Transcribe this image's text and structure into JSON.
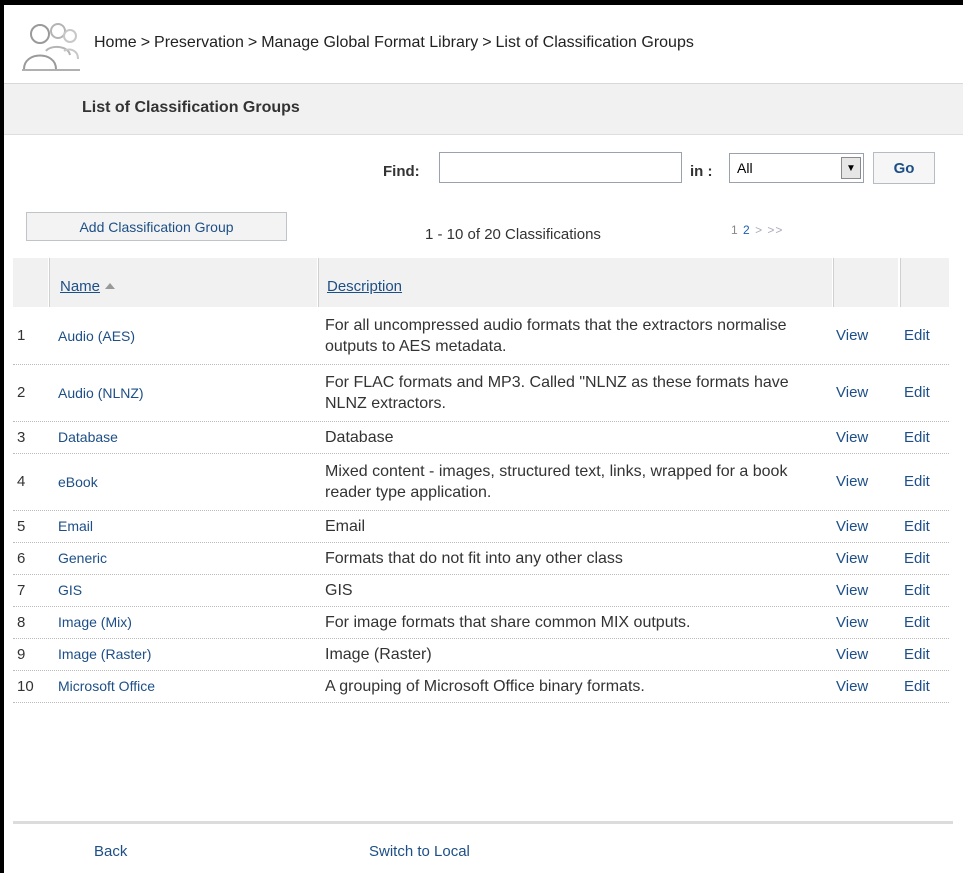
{
  "breadcrumb": [
    "Home",
    "Preservation",
    "Manage Global Format Library",
    "List of Classification Groups"
  ],
  "breadcrumb_separator": ">",
  "page_title": "List of Classification Groups",
  "find": {
    "label": "Find:",
    "value": "",
    "in_label": "in :",
    "in_selected": "All",
    "go_label": "Go"
  },
  "toolbar": {
    "add_label": "Add Classification Group",
    "count_text": "1 - 10 of 20 Classifications",
    "pages": [
      "1",
      "2"
    ],
    "next": ">",
    "last": ">>"
  },
  "table": {
    "columns": {
      "name": "Name",
      "description": "Description"
    },
    "rows": [
      {
        "num": "1",
        "name": "Audio (AES)",
        "desc": "For all uncompressed audio formats that the extractors normalise outputs to AES metadata.",
        "view": "View",
        "edit": "Edit"
      },
      {
        "num": "2",
        "name": "Audio (NLNZ)",
        "desc": "For FLAC formats and MP3. Called \"NLNZ as these formats have NLNZ extractors.",
        "view": "View",
        "edit": "Edit"
      },
      {
        "num": "3",
        "name": "Database",
        "desc": "Database",
        "view": "View",
        "edit": "Edit"
      },
      {
        "num": "4",
        "name": "eBook",
        "desc": "Mixed content - images, structured text, links, wrapped for a book reader type application.",
        "view": "View",
        "edit": "Edit"
      },
      {
        "num": "5",
        "name": "Email",
        "desc": "Email",
        "view": "View",
        "edit": "Edit"
      },
      {
        "num": "6",
        "name": "Generic",
        "desc": "Formats that do not fit into any other class",
        "view": "View",
        "edit": "Edit"
      },
      {
        "num": "7",
        "name": "GIS",
        "desc": "GIS",
        "view": "View",
        "edit": "Edit"
      },
      {
        "num": "8",
        "name": "Image (Mix)",
        "desc": "For image formats that share common MIX outputs.",
        "view": "View",
        "edit": "Edit"
      },
      {
        "num": "9",
        "name": "Image (Raster)",
        "desc": "Image (Raster)",
        "view": "View",
        "edit": "Edit"
      },
      {
        "num": "10",
        "name": "Microsoft Office",
        "desc": "A grouping of Microsoft Office binary formats.",
        "view": "View",
        "edit": "Edit"
      }
    ]
  },
  "footer": {
    "back_label": "Back",
    "switch_label": "Switch to Local"
  },
  "colors": {
    "link": "#1d4f86",
    "header_bg": "#f1f1f1"
  }
}
